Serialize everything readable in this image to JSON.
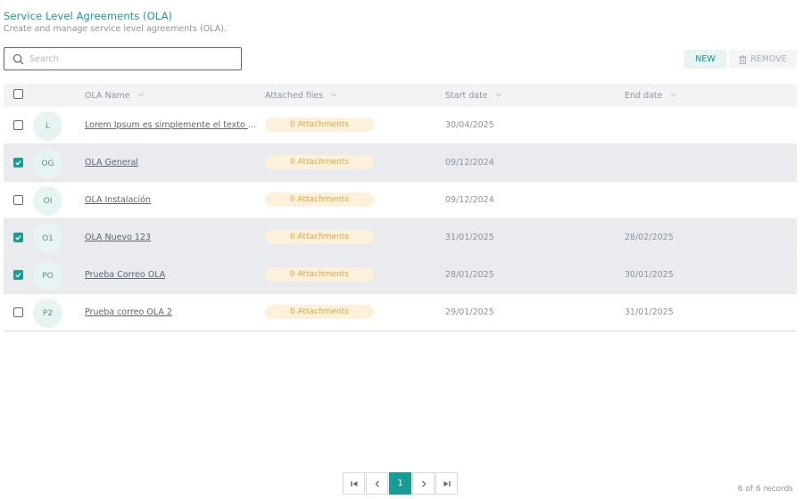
{
  "page": {
    "title": "Service Level Agreements (OLA)",
    "subtitle": "Create and manage service level agreements (OLA)."
  },
  "search": {
    "placeholder": "Search",
    "value": ""
  },
  "toolbar": {
    "new_label": "NEW",
    "remove_label": "REMOVE"
  },
  "table": {
    "headers": {
      "name": "OLA Name",
      "files": "Attached files",
      "start": "Start date",
      "end": "End date"
    },
    "rows": [
      {
        "initials": "L",
        "name": "Lorem Ipsum es simplemente el texto de ...",
        "attachments": "0 Attachments",
        "start": "30/04/2025",
        "end": "",
        "selected": false
      },
      {
        "initials": "OG",
        "name": "OLA General",
        "attachments": "0 Attachments",
        "start": "09/12/2024",
        "end": "",
        "selected": true
      },
      {
        "initials": "OI",
        "name": "OLA Instalación",
        "attachments": "0 Attachments",
        "start": "09/12/2024",
        "end": "",
        "selected": false
      },
      {
        "initials": "O1",
        "name": "OLA Nuevo 123",
        "attachments": "0 Attachments",
        "start": "31/01/2025",
        "end": "28/02/2025",
        "selected": true
      },
      {
        "initials": "PO",
        "name": "Prueba Correo OLA",
        "attachments": "0 Attachments",
        "start": "28/01/2025",
        "end": "30/01/2025",
        "selected": true
      },
      {
        "initials": "P2",
        "name": "Prueba correo OLA 2",
        "attachments": "0 Attachments",
        "start": "29/01/2025",
        "end": "31/01/2025",
        "selected": false
      }
    ]
  },
  "pagination": {
    "current_page": "1",
    "records": "6 of 6 records"
  },
  "colors": {
    "accent": "#1a9b94",
    "attachment_bg": "#fdf1dc",
    "attachment_text": "#e9a33e"
  }
}
